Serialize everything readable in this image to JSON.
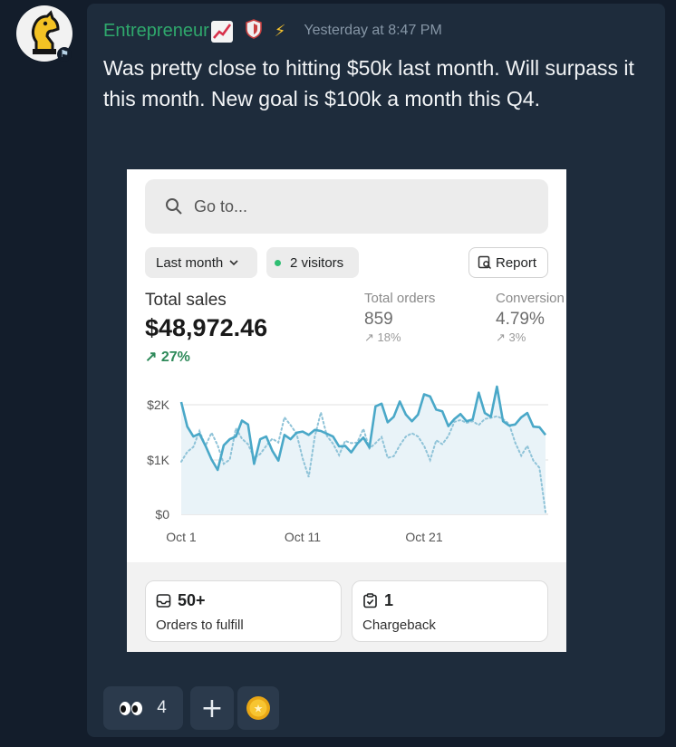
{
  "message": {
    "author": "Entrepreneur",
    "timestamp": "Yesterday at 8:47 PM",
    "icons": [
      "chart-increasing-emoji",
      "shield-icon",
      "lightning-icon",
      "knight-avatar"
    ],
    "text": "Was pretty close to hitting $50k last month. Will surpass it this month. New goal is $100k a month this Q4."
  },
  "dashboard": {
    "search_placeholder": "Go to...",
    "filter_period": "Last month",
    "visitors": "2 visitors",
    "report_label": "Report",
    "total_sales_label": "Total sales",
    "total_sales_value": "$48,972.46",
    "total_sales_delta": "27%",
    "kpis": [
      {
        "label": "Total orders",
        "value": "859",
        "delta": "18%"
      },
      {
        "label": "Conversion",
        "value": "4.79%",
        "delta": "3%"
      }
    ],
    "tiles": [
      {
        "value": "50+",
        "label": "Orders to fulfill",
        "icon": "inbox-icon"
      },
      {
        "value": "1",
        "label": "Chargeback",
        "icon": "clipboard-check-icon"
      }
    ],
    "colors": {
      "accent_green": "#2e8a5a",
      "line": "#4aa8c8"
    }
  },
  "chart_data": {
    "type": "line",
    "y_tick_labels": [
      "$2K",
      "$1K",
      "$0"
    ],
    "x_tick_labels": [
      "Oct 1",
      "Oct 11",
      "Oct 21"
    ],
    "ylim": [
      0,
      2000
    ],
    "x_tick_positions": [
      1,
      11,
      21
    ],
    "series": [
      {
        "style": "solid",
        "x": [
          0,
          0.5,
          1,
          1.5,
          2,
          2.5,
          3,
          3.5,
          4,
          4.5,
          5,
          5.5,
          6,
          6.5,
          7,
          7.5,
          8,
          8.5,
          9,
          9.5,
          10,
          10.5,
          11,
          11.5,
          12,
          12.5,
          13,
          13.5,
          14,
          14.5,
          15,
          15.5,
          16,
          16.5,
          17,
          17.5,
          18,
          18.5,
          19,
          19.5,
          20,
          20.5,
          21,
          21.5,
          22,
          22.5,
          23,
          23.5,
          24,
          24.5,
          25,
          25.5,
          26,
          26.5,
          27,
          27.5,
          28,
          28.5,
          29,
          29.5,
          30
        ],
        "y": [
          2050,
          1600,
          1420,
          1470,
          1250,
          1000,
          810,
          1260,
          1370,
          1420,
          1710,
          1640,
          920,
          1370,
          1420,
          1160,
          980,
          1450,
          1370,
          1490,
          1510,
          1450,
          1540,
          1520,
          1470,
          1420,
          1240,
          1250,
          1130,
          1290,
          1400,
          1220,
          1970,
          2020,
          1680,
          1780,
          2060,
          1820,
          1700,
          1820,
          2190,
          2150,
          1910,
          1880,
          1610,
          1740,
          1830,
          1700,
          1730,
          2220,
          1850,
          1780,
          2330,
          1700,
          1620,
          1640,
          1770,
          1850,
          1600,
          1590,
          1450
        ]
      },
      {
        "style": "dotted",
        "x": [
          0,
          0.5,
          1,
          1.5,
          2,
          2.5,
          3,
          3.5,
          4,
          4.5,
          5,
          5.5,
          6,
          6.5,
          7,
          7.5,
          8,
          8.5,
          9,
          9.5,
          10,
          10.5,
          11,
          11.5,
          12,
          12.5,
          13,
          13.5,
          14,
          14.5,
          15,
          15.5,
          16,
          16.5,
          17,
          17.5,
          18,
          18.5,
          19,
          19.5,
          20,
          20.5,
          21,
          21.5,
          22,
          22.5,
          23,
          23.5,
          24,
          24.5,
          25,
          25.5,
          26,
          26.5,
          27,
          27.5,
          28,
          28.5,
          29,
          29.5,
          30
        ],
        "y": [
          960,
          1140,
          1230,
          1520,
          1250,
          1490,
          1260,
          920,
          1000,
          1570,
          1380,
          1280,
          1030,
          1100,
          1250,
          1380,
          1310,
          1770,
          1630,
          1470,
          1020,
          680,
          1420,
          1860,
          1430,
          1290,
          1080,
          1340,
          1300,
          1310,
          1560,
          1200,
          1300,
          1410,
          1030,
          1060,
          1260,
          1420,
          1480,
          1420,
          1250,
          990,
          1350,
          1280,
          1430,
          1690,
          1720,
          1670,
          1700,
          1630,
          1740,
          1760,
          1790,
          1740,
          1650,
          1310,
          1070,
          1250,
          980,
          850,
          40
        ]
      }
    ]
  },
  "reactions": [
    {
      "emoji": "eyes",
      "count": "4"
    },
    {
      "emoji": "add",
      "label": "+"
    },
    {
      "emoji": "coin"
    }
  ]
}
